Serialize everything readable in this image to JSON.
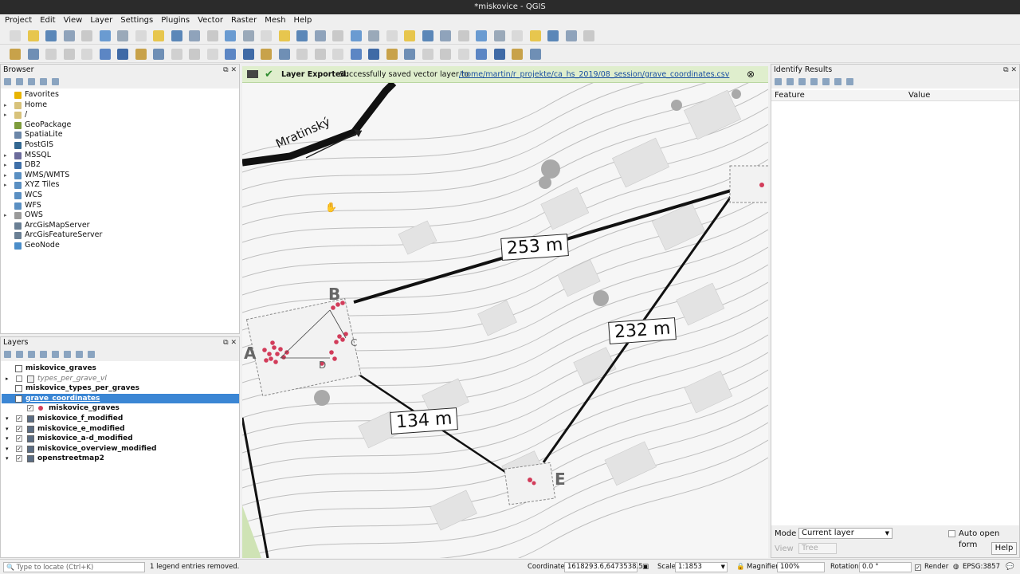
{
  "window": {
    "title": "*miskovice - QGIS"
  },
  "menu": [
    "Project",
    "Edit",
    "View",
    "Layer",
    "Settings",
    "Plugins",
    "Vector",
    "Raster",
    "Mesh",
    "Help"
  ],
  "browser": {
    "title": "Browser",
    "items": [
      {
        "label": "Favorites",
        "icon": "star-icon",
        "color": "#e8b400",
        "expand": false
      },
      {
        "label": "Home",
        "icon": "folder-icon",
        "color": "#d8c27a",
        "expand": true
      },
      {
        "label": "/",
        "icon": "folder-icon",
        "color": "#d8c27a",
        "expand": true
      },
      {
        "label": "GeoPackage",
        "icon": "geopackage-icon",
        "color": "#7e9c3c",
        "expand": false
      },
      {
        "label": "SpatiaLite",
        "icon": "spatialite-icon",
        "color": "#6b86a8",
        "expand": false
      },
      {
        "label": "PostGIS",
        "icon": "postgis-icon",
        "color": "#336791",
        "expand": false
      },
      {
        "label": "MSSQL",
        "icon": "mssql-icon",
        "color": "#6b6b9b",
        "expand": true
      },
      {
        "label": "DB2",
        "icon": "db2-icon",
        "color": "#3e6fa8",
        "expand": true
      },
      {
        "label": "WMS/WMTS",
        "icon": "wms-icon",
        "color": "#5a8fc2",
        "expand": true
      },
      {
        "label": "XYZ Tiles",
        "icon": "xyz-icon",
        "color": "#5a8fc2",
        "expand": true
      },
      {
        "label": "WCS",
        "icon": "wcs-icon",
        "color": "#5a8fc2",
        "expand": false
      },
      {
        "label": "WFS",
        "icon": "wfs-icon",
        "color": "#5a8fc2",
        "expand": false
      },
      {
        "label": "OWS",
        "icon": "ows-icon",
        "color": "#9a9a9a",
        "expand": true
      },
      {
        "label": "ArcGisMapServer",
        "icon": "arcgis-icon",
        "color": "#6a7f94",
        "expand": false
      },
      {
        "label": "ArcGisFeatureServer",
        "icon": "arcgis-icon",
        "color": "#6a7f94",
        "expand": false
      },
      {
        "label": "GeoNode",
        "icon": "geonode-icon",
        "color": "#4b8dc9",
        "expand": false
      }
    ]
  },
  "layers": {
    "title": "Layers",
    "items": [
      {
        "label": "miskovice_graves",
        "check": "none",
        "type": "table",
        "italic": false,
        "selected": false,
        "indent": 0
      },
      {
        "label": "types_per_grave_vl",
        "check": "box",
        "type": "virtual",
        "italic": true,
        "selected": false,
        "indent": 0
      },
      {
        "label": "miskovice_types_per_graves",
        "check": "none",
        "type": "table",
        "italic": false,
        "selected": false,
        "indent": 0
      },
      {
        "label": "grave_coordinates",
        "check": "none",
        "type": "table",
        "italic": false,
        "selected": true,
        "indent": 0
      },
      {
        "label": "miskovice_graves",
        "check": "checked",
        "type": "point",
        "italic": false,
        "selected": false,
        "indent": 1
      },
      {
        "label": "miskovice_f_modified",
        "check": "checked",
        "type": "raster",
        "italic": false,
        "selected": false,
        "indent": 0
      },
      {
        "label": "miskovice_e_modified",
        "check": "checked",
        "type": "raster",
        "italic": false,
        "selected": false,
        "indent": 0
      },
      {
        "label": "miskovice_a-d_modified",
        "check": "checked",
        "type": "raster",
        "italic": false,
        "selected": false,
        "indent": 0
      },
      {
        "label": "miskovice_overview_modified",
        "check": "checked",
        "type": "raster",
        "italic": false,
        "selected": false,
        "indent": 0
      },
      {
        "label": "openstreetmap2",
        "check": "checked",
        "type": "raster",
        "italic": false,
        "selected": false,
        "indent": 0
      }
    ]
  },
  "message": {
    "title": "Layer Exported:",
    "text": "Successfully saved vector layer to",
    "link": "/home/martin/r_projekte/ca_hs_2019/08_session/grave_coordinates.csv"
  },
  "map": {
    "street": "Mratinský",
    "distances": [
      "253 m",
      "232 m",
      "134 m"
    ],
    "points": [
      "A",
      "B",
      "C",
      "D",
      "E"
    ]
  },
  "identify": {
    "title": "Identify Results",
    "col_feature": "Feature",
    "col_value": "Value",
    "mode_label": "Mode",
    "mode_value": "Current layer",
    "auto_open": "Auto open form",
    "view_label": "View",
    "view_value": "Tree",
    "help": "Help"
  },
  "status": {
    "locate_placeholder": "Type to locate (Ctrl+K)",
    "message": "1 legend entries removed.",
    "coord_label": "Coordinate",
    "coord_value": "1618293.6,6473538.5",
    "scale_label": "Scale",
    "scale_value": "1:1853",
    "magnifier_label": "Magnifier",
    "magnifier_value": "100%",
    "rotation_label": "Rotation",
    "rotation_value": "0.0 °",
    "render_label": "Render",
    "crs": "EPSG:3857"
  },
  "colors": {
    "accent": "#3b86d4",
    "message_bg": "#dfeecd",
    "point_red": "#d23c5a"
  }
}
